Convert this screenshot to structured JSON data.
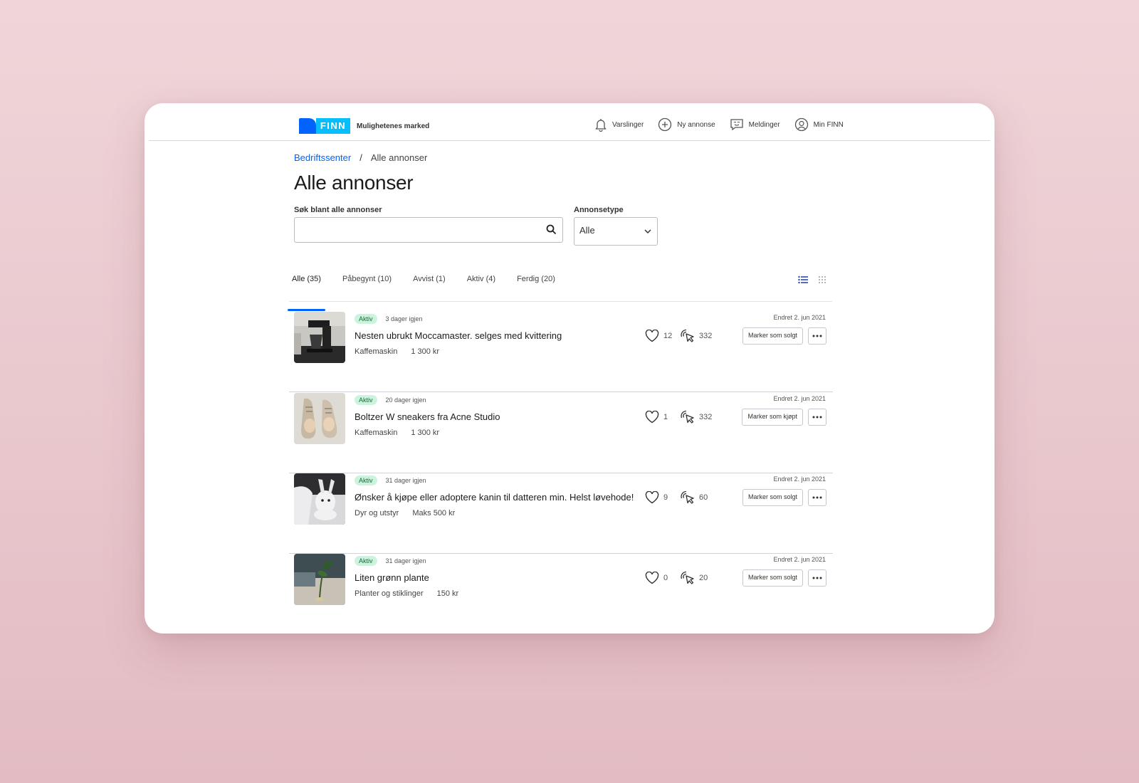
{
  "header": {
    "logo_text": "FINN",
    "slogan": "Mulighetenes marked",
    "nav": [
      {
        "label": "Varslinger",
        "icon": "bell-icon"
      },
      {
        "label": "Ny annonse",
        "icon": "plus-circle-icon"
      },
      {
        "label": "Meldinger",
        "icon": "chat-icon"
      },
      {
        "label": "Min FINN",
        "icon": "user-circle-icon"
      }
    ]
  },
  "breadcrumb": {
    "parent": "Bedriftssenter",
    "separator": "/",
    "current": "Alle annonser"
  },
  "page_title": "Alle annonser",
  "search": {
    "label": "Søk blant alle annonser",
    "value": "",
    "placeholder": ""
  },
  "ad_type": {
    "label": "Annonsetype",
    "value": "Alle"
  },
  "tabs": [
    {
      "label": "Alle (35)",
      "active": true
    },
    {
      "label": "Påbegynt (10)",
      "active": false
    },
    {
      "label": "Avvist (1)",
      "active": false
    },
    {
      "label": "Aktiv (4)",
      "active": false
    },
    {
      "label": "Ferdig (20)",
      "active": false
    }
  ],
  "listings": [
    {
      "status": "Aktiv",
      "days_left": "3 dager igjen",
      "title": "Nesten ubrukt Moccamaster. selges med kvittering",
      "category": "Kaffemaskin",
      "price": "1 300 kr",
      "likes": "12",
      "clicks": "332",
      "edited": "Endret 2. jun 2021",
      "action": "Marker som solgt",
      "image": "coffee-maker"
    },
    {
      "status": "Aktiv",
      "days_left": "20 dager igjen",
      "title": "Boltzer W sneakers fra Acne Studio",
      "category": "Kaffemaskin",
      "price": "1 300 kr",
      "likes": "1",
      "clicks": "332",
      "edited": "Endret 2. jun 2021",
      "action": "Marker som kjøpt",
      "image": "sneakers"
    },
    {
      "status": "Aktiv",
      "days_left": "31 dager igjen",
      "title": "Ønsker å kjøpe eller adoptere kanin til datteren min. Helst løvehode!",
      "category": "Dyr og utstyr",
      "price": "Maks 500 kr",
      "likes": "9",
      "clicks": "60",
      "edited": "Endret 2. jun 2021",
      "action": "Marker som solgt",
      "image": "rabbit"
    },
    {
      "status": "Aktiv",
      "days_left": "31 dager igjen",
      "title": "Liten grønn plante",
      "category": "Planter og stiklinger",
      "price": "150 kr",
      "likes": "0",
      "clicks": "20",
      "edited": "Endret 2. jun 2021",
      "action": "Marker som solgt",
      "image": "plant"
    }
  ],
  "colors": {
    "brand_blue": "#0063fb",
    "brand_cyan": "#06befb",
    "badge_bg": "#ccf3dd",
    "background": "#e8c8ce"
  }
}
